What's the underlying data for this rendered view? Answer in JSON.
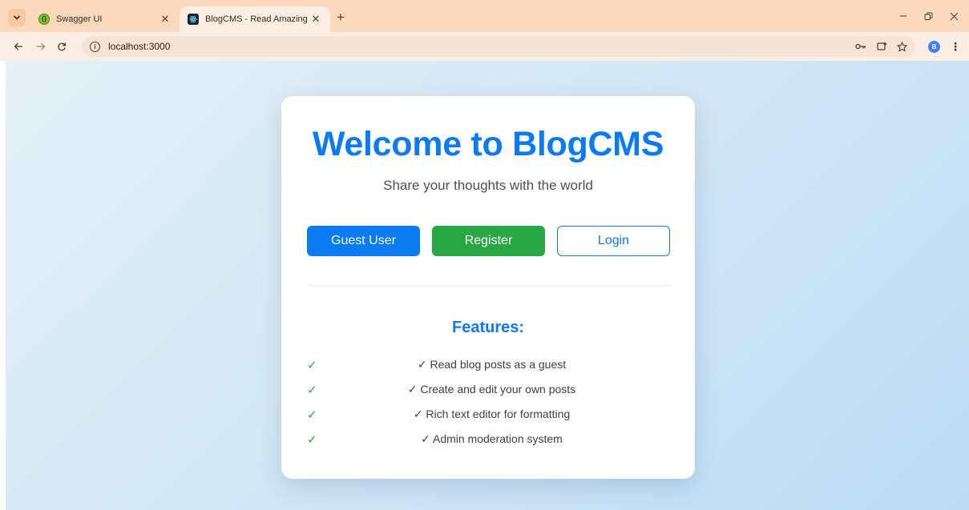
{
  "browser": {
    "tabs": [
      {
        "title": "Swagger UI",
        "favicon": "swagger-icon",
        "active": false
      },
      {
        "title": "BlogCMS - Read Amazing Blog",
        "favicon": "react-icon",
        "active": true
      }
    ],
    "address": {
      "url": "localhost:3000"
    },
    "profile_initial": "B",
    "colors": {
      "tabstrip": "#fcd9bc",
      "toolbar": "#fbeee4"
    }
  },
  "page": {
    "title": "Welcome to BlogCMS",
    "subtitle": "Share your thoughts with the world",
    "buttons": {
      "guest": "Guest User",
      "register": "Register",
      "login": "Login"
    },
    "features_heading": "Features:",
    "features": [
      {
        "check": "✓",
        "text": "✓ Read blog posts as a guest"
      },
      {
        "check": "✓",
        "text": "✓ Create and edit your own posts"
      },
      {
        "check": "✓",
        "text": "✓ Rich text editor for formatting"
      },
      {
        "check": "✓",
        "text": "✓ Admin moderation system"
      }
    ],
    "colors": {
      "primary": "#0a7bf0",
      "success": "#29a745"
    }
  }
}
